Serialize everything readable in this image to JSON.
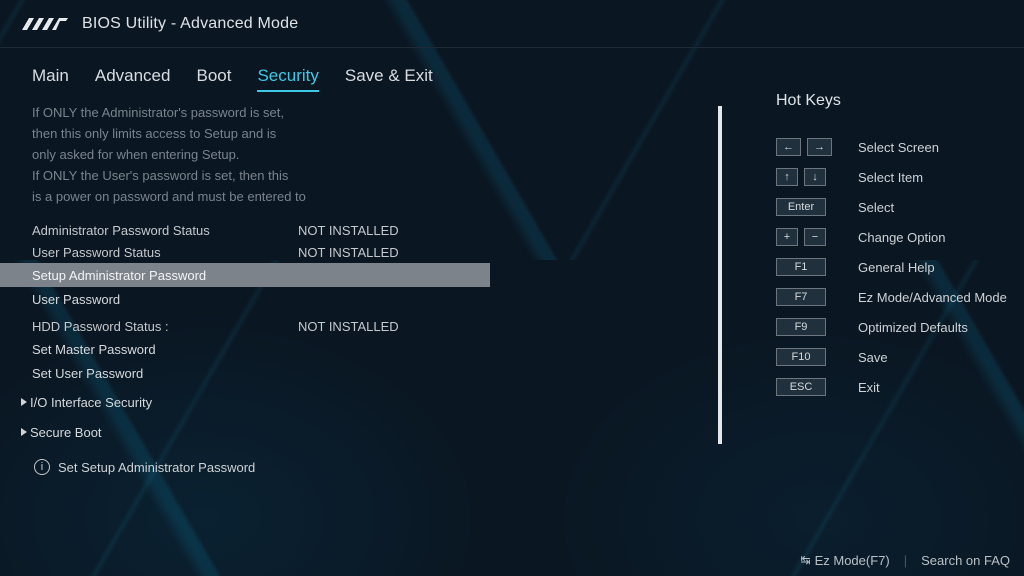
{
  "header": {
    "brand": "ASUS",
    "title": "BIOS Utility - Advanced Mode"
  },
  "tabs": [
    {
      "id": "main",
      "label": "Main",
      "active": false
    },
    {
      "id": "advanced",
      "label": "Advanced",
      "active": false
    },
    {
      "id": "boot",
      "label": "Boot",
      "active": false
    },
    {
      "id": "security",
      "label": "Security",
      "active": true
    },
    {
      "id": "saveexit",
      "label": "Save & Exit",
      "active": false
    }
  ],
  "help_lines": [
    "If ONLY the Administrator's password is set,",
    "then this only limits access to Setup and is",
    "only asked for when entering Setup.",
    "If ONLY the User's password is set, then this",
    "is a power on password and must be entered to"
  ],
  "status": {
    "admin_pw_label": "Administrator Password Status",
    "admin_pw_value": "NOT INSTALLED",
    "user_pw_label": "User Password Status",
    "user_pw_value": "NOT INSTALLED",
    "hdd_pw_label": "HDD Password Status  :",
    "hdd_pw_value": "NOT INSTALLED"
  },
  "menu": {
    "setup_admin_pw": "Setup Administrator Password",
    "user_pw": "User Password",
    "set_master_pw": "Set Master Password",
    "set_user_pw": "Set User Password",
    "io_sec": "I/O Interface Security",
    "secure_boot": "Secure Boot"
  },
  "hint_text": "Set Setup Administrator Password",
  "hotkeys": {
    "title": "Hot Keys",
    "rows": [
      {
        "keys": [
          "←",
          "→"
        ],
        "wide": false,
        "desc": "Select Screen"
      },
      {
        "keys": [
          "↑",
          "↓"
        ],
        "wide": false,
        "desc": "Select Item"
      },
      {
        "keys": [
          "Enter"
        ],
        "wide": true,
        "desc": "Select"
      },
      {
        "keys": [
          "+",
          "−"
        ],
        "wide": false,
        "desc": "Change Option"
      },
      {
        "keys": [
          "F1"
        ],
        "wide": true,
        "desc": "General Help"
      },
      {
        "keys": [
          "F7"
        ],
        "wide": true,
        "desc": "Ez Mode/Advanced Mode"
      },
      {
        "keys": [
          "F9"
        ],
        "wide": true,
        "desc": "Optimized Defaults"
      },
      {
        "keys": [
          "F10"
        ],
        "wide": true,
        "desc": "Save"
      },
      {
        "keys": [
          "ESC"
        ],
        "wide": true,
        "desc": "Exit"
      }
    ]
  },
  "footer": {
    "ezmode": "Ez Mode(F7)",
    "faq": "Search on FAQ"
  }
}
